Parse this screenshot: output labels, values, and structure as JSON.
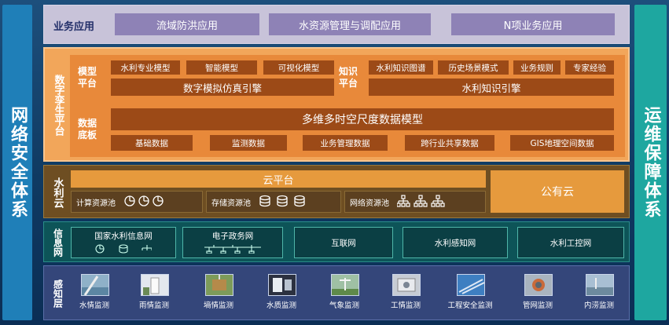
{
  "left_side": "网络安全体系",
  "right_side": "运维保障体系",
  "business": {
    "title": "业务应用",
    "apps": [
      "流域防洪应用",
      "水资源管理与调配应用",
      "N项业务应用"
    ]
  },
  "digital_twin": {
    "title": "数字孪生平台",
    "model_platform": {
      "label": "模型平台",
      "items": [
        "水利专业模型",
        "智能模型",
        "可视化模型"
      ],
      "engine": "数字模拟仿真引擎"
    },
    "knowledge_platform": {
      "label": "知识平台",
      "items": [
        "水利知识图谱",
        "历史场景模式",
        "业务规则",
        "专家经验"
      ],
      "engine": "水利知识引擎"
    },
    "data_board": {
      "label": "数据底板",
      "model": "多维多时空尺度数据模型",
      "items": [
        "基础数据",
        "监测数据",
        "业务管理数据",
        "跨行业共享数据",
        "GIS地理空间数据"
      ]
    }
  },
  "water_cloud": {
    "title": "水利云",
    "cloud_platform": "云平台",
    "pools": [
      "计算资源池",
      "存储资源池",
      "网络资源池"
    ],
    "public_cloud": "公有云"
  },
  "info_network": {
    "title": "信息网",
    "networks": [
      "国家水利信息网",
      "电子政务网",
      "互联网",
      "水利感知网",
      "水利工控网"
    ]
  },
  "sensing": {
    "title": "感知层",
    "items": [
      "水情监测",
      "雨情监测",
      "墒情监测",
      "水质监测",
      "气象监测",
      "工情监测",
      "工程安全监测",
      "管网监测",
      "内涝监测"
    ]
  },
  "colors": {
    "security_bar": "#1f7fb8",
    "ops_bar": "#1ea7a0",
    "digital_twin": "#e8893a",
    "water_cloud": "#6e4e22",
    "info_network": "#0d5458",
    "sensing": "#34467a"
  }
}
